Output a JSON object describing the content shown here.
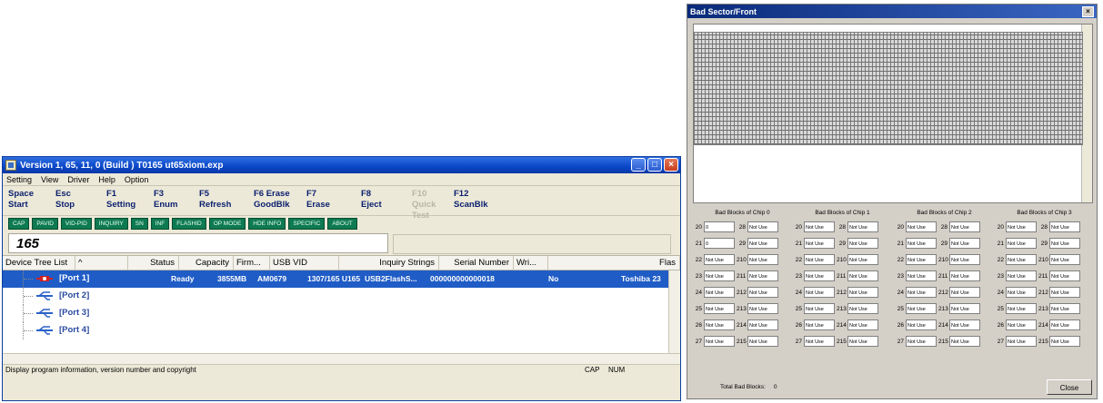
{
  "main_window": {
    "title": "Version 1, 65, 11, 0 (Build ) T0165 ut65xiom.exp",
    "menu": [
      "Setting",
      "View",
      "Driver",
      "Help",
      "Option"
    ],
    "toolbar": [
      {
        "key": "Space",
        "label": "Start"
      },
      {
        "key": "Esc",
        "label": "Stop"
      },
      {
        "key": "F1",
        "label": "Setting"
      },
      {
        "key": "F3",
        "label": "Enum"
      },
      {
        "key": "F5",
        "label": "Refresh"
      },
      {
        "key": "F6 Erase",
        "label": "GoodBlk"
      },
      {
        "key": "F7",
        "label": "Erase"
      },
      {
        "key": "F8",
        "label": "Eject"
      },
      {
        "key": "F10",
        "label": "Quick Test",
        "disabled": true
      },
      {
        "key": "F12",
        "label": "ScanBlk"
      }
    ],
    "tags": [
      "CAP",
      "PAVID",
      "VID-PID",
      "INQUIRY",
      "SN",
      "INF",
      "FLASHID",
      "OP MODE",
      "HDE INFO",
      "SPECIFIC",
      "ABOUT"
    ],
    "count": "165",
    "columns": [
      "Device Tree List",
      "^",
      "Status",
      "Capacity",
      "Firm...",
      "USB VID",
      "Inquiry Strings",
      "Serial Number",
      "Wri...",
      "Flas"
    ],
    "rows": [
      {
        "port": "[Port 1]",
        "status": "Ready",
        "capacity": "3855MB",
        "firmware": "AM0679",
        "usb": "1307/165 U165",
        "inquiry": "USB2FlashS...",
        "serial": "000000000000018",
        "write": "No",
        "flash": "Toshiba 23"
      },
      {
        "port": "[Port 2]"
      },
      {
        "port": "[Port 3]"
      },
      {
        "port": "[Port 4]"
      }
    ],
    "status_text": "Display program information, version number and copyright",
    "status_right": [
      "CAP",
      "NUM"
    ]
  },
  "bad_window": {
    "title": "Bad Sector/Front",
    "chips": [
      {
        "header": "Bad Blocks of Chip 0",
        "left": [
          "0",
          "0",
          "Not Use",
          "Not Use",
          "Not Use",
          "Not Use",
          "Not Use",
          "Not Use"
        ],
        "right": [
          "Not Use",
          "Not Use",
          "Not Use",
          "Not Use",
          "Not Use",
          "Not Use",
          "Not Use",
          "Not Use"
        ]
      },
      {
        "header": "Bad Blocks of Chip 1",
        "left": [
          "Not Use",
          "Not Use",
          "Not Use",
          "Not Use",
          "Not Use",
          "Not Use",
          "Not Use",
          "Not Use"
        ],
        "right": [
          "Not Use",
          "Not Use",
          "Not Use",
          "Not Use",
          "Not Use",
          "Not Use",
          "Not Use",
          "Not Use"
        ]
      },
      {
        "header": "Bad Blocks of Chip 2",
        "left": [
          "Not Use",
          "Not Use",
          "Not Use",
          "Not Use",
          "Not Use",
          "Not Use",
          "Not Use",
          "Not Use"
        ],
        "right": [
          "Not Use",
          "Not Use",
          "Not Use",
          "Not Use",
          "Not Use",
          "Not Use",
          "Not Use",
          "Not Use"
        ]
      },
      {
        "header": "Bad Blocks of Chip 3",
        "left": [
          "Not Use",
          "Not Use",
          "Not Use",
          "Not Use",
          "Not Use",
          "Not Use",
          "Not Use",
          "Not Use"
        ],
        "right": [
          "Not Use",
          "Not Use",
          "Not Use",
          "Not Use",
          "Not Use",
          "Not Use",
          "Not Use",
          "Not Use"
        ]
      }
    ],
    "left_indices": [
      "20",
      "21",
      "22",
      "23",
      "24",
      "25",
      "26",
      "27"
    ],
    "right_indices": [
      "28",
      "29",
      "210",
      "211",
      "212",
      "213",
      "214",
      "215"
    ],
    "total_label": "Total Bad Blocks:",
    "total_value": "0",
    "close_label": "Close"
  }
}
